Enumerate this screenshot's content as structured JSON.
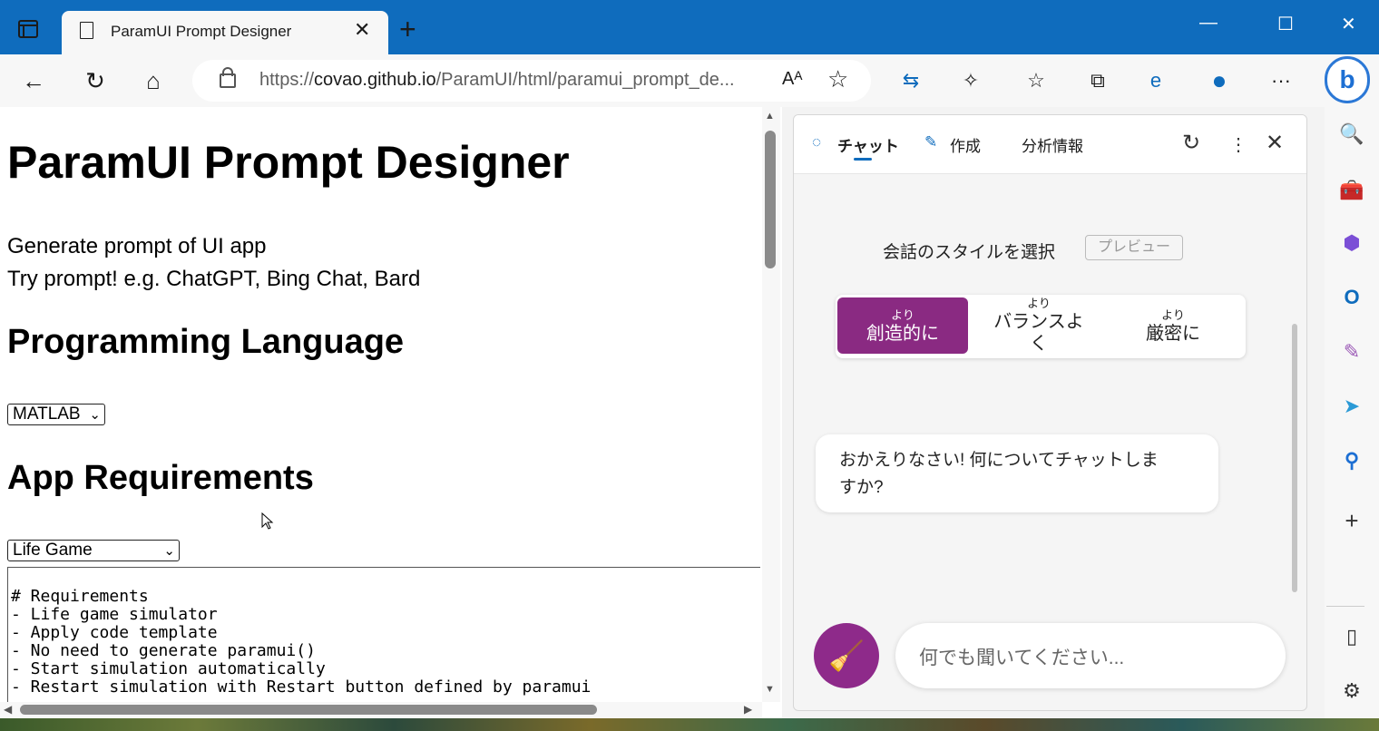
{
  "browser": {
    "tab_title": "ParamUI Prompt Designer",
    "url_host_prefix": "https://",
    "url_host": "covao.github.io",
    "url_path": "/ParamUI/html/paramui_prompt_de...",
    "read_aloud_label": "Aᴬ",
    "new_tab_label": "+",
    "icons": {
      "sidebar_toggle": "sidebar-icon",
      "back": "back-arrow-icon",
      "refresh": "refresh-icon",
      "home": "home-icon",
      "lock": "lock-icon",
      "favorite_add": "favorite-add-icon",
      "extensions": "puzzle-icon",
      "favorites": "favorites-icon",
      "collections": "collections-icon",
      "profile": "profile-icon",
      "more": "ellipsis-icon",
      "bing": "bing-icon"
    }
  },
  "page": {
    "title": "ParamUI Prompt Designer",
    "desc_line1": "Generate prompt of UI app",
    "desc_line2": "Try prompt! e.g. ChatGPT, Bing Chat, Bard",
    "lang_heading": "Programming Language",
    "lang_selected": "MATLAB",
    "req_heading": "App Requirements",
    "req_selected": "Life Game",
    "req_text": "# Requirements\n- Life game simulator\n- Apply code template\n- No need to generate paramui()\n- Start simulation automatically\n- Restart simulation with Restart button defined by paramui"
  },
  "copilot": {
    "tabs": [
      "チャット",
      "作成",
      "分析情報"
    ],
    "style_label": "会話のスタイルを選択",
    "preview_badge": "プレビュー",
    "modes": [
      {
        "small": "より",
        "main": "創造的に",
        "active": true
      },
      {
        "small": "より",
        "main": "バランスよ",
        "main2": "く",
        "active": false
      },
      {
        "small": "より",
        "main": "厳密に",
        "active": false
      }
    ],
    "greeting_line1": "おかえりなさい! 何についてチャットしま",
    "greeting_line2": "すか?",
    "input_placeholder": "何でも聞いてください...",
    "accent": "#8a2a82"
  },
  "colors": {
    "titlebar": "#0f6cbd",
    "tab_bg": "#f7f7f7"
  }
}
